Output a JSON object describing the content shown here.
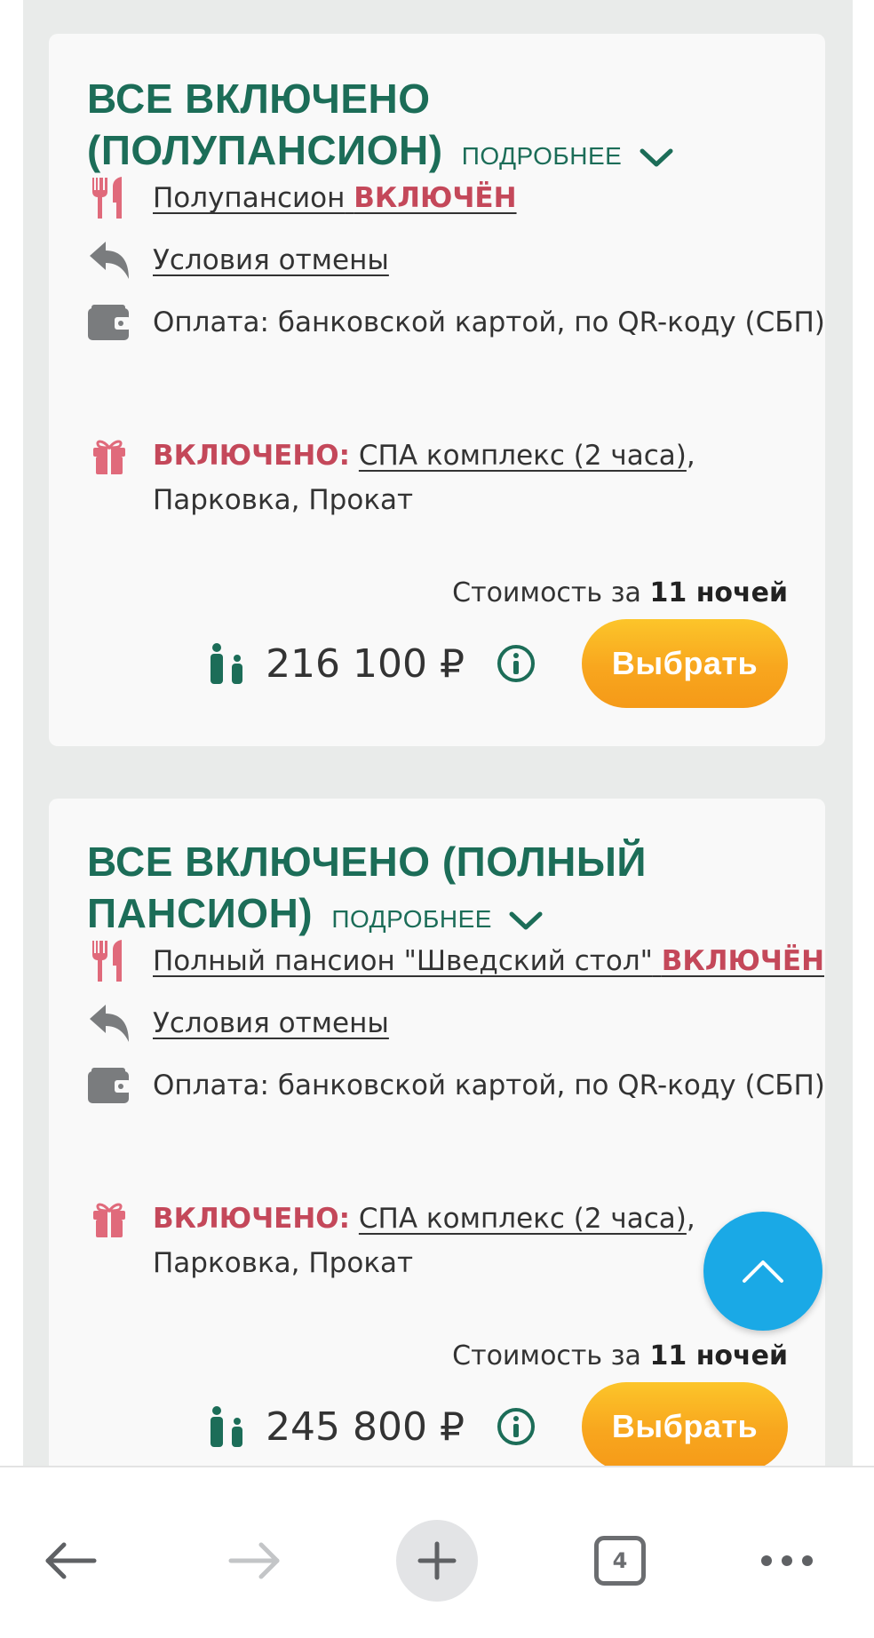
{
  "offers": [
    {
      "title": "ВСЕ ВКЛЮЧЕНО (ПОЛУПАНСИОН)",
      "more_label": "ПОДРОБНЕЕ",
      "meal_text": "Полупансион",
      "meal_status": "ВКЛЮЧЁН",
      "cancel_label": "Условия отмены",
      "payment_text": "Оплата: банковской картой, по QR-коду (СБП)",
      "included_label": "ВКЛЮЧЕНО:",
      "included_link": "СПА комплекс (2 часа)",
      "included_rest": ", Парковка, Прокат",
      "cost_label": "Стоимость за",
      "cost_nights": "11 ночей",
      "price": "216 100 ₽",
      "select_label": "Выбрать"
    },
    {
      "title": "ВСЕ ВКЛЮЧЕНО (ПОЛНЫЙ ПАНСИОН)",
      "more_label": "ПОДРОБНЕЕ",
      "meal_text": "Полный пансион \"Шведский стол\"",
      "meal_status": "ВКЛЮЧЁН",
      "cancel_label": "Условия отмены",
      "payment_text": "Оплата: банковской картой, по QR-коду (СБП)",
      "included_label": "ВКЛЮЧЕНО:",
      "included_link": "СПА комплекс (2 часа)",
      "included_rest": ", Парковка, Прокат",
      "cost_label": "Стоимость за",
      "cost_nights": "11 ночей",
      "price": "245 800 ₽",
      "select_label": "Выбрать"
    }
  ],
  "browser_nav": {
    "tabs_count": "4"
  },
  "icons": {
    "meal": "fork-knife-icon",
    "cancel": "undo-arrow-icon",
    "payment": "wallet-icon",
    "included": "gift-icon",
    "guests": "adult-child-icon",
    "info": "info-icon",
    "more": "chevron-down-icon",
    "scroll_top": "chevron-up-icon"
  },
  "colors": {
    "title": "#1c6d58",
    "accent_red": "#c4485a",
    "button": "#f8a61e",
    "scroll_top": "#1aa9e6"
  }
}
